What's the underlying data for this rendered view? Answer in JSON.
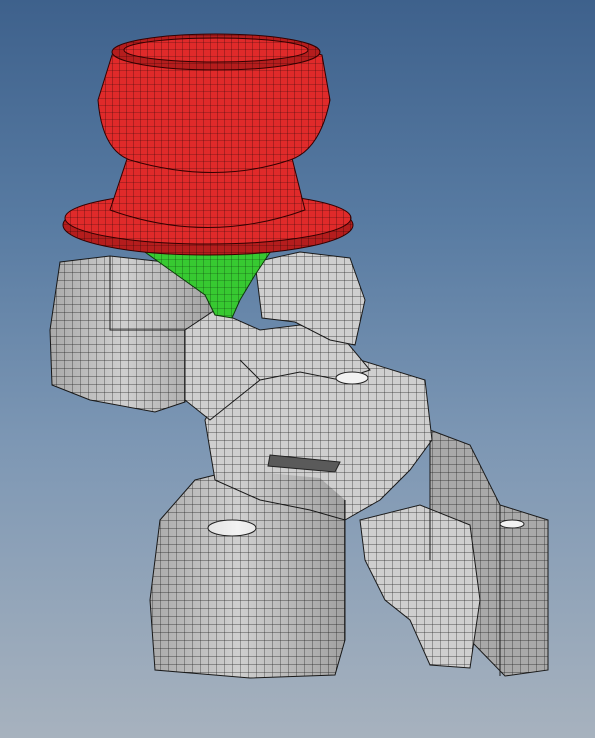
{
  "viewport": {
    "background_top": "#3e618c",
    "background_bottom": "#a7b2be"
  },
  "parts": [
    {
      "id": "bushing-cap",
      "kind": "mesh-part",
      "color": "#e02a2a"
    },
    {
      "id": "rubber-core",
      "kind": "mesh-part",
      "color": "#2fc42a"
    },
    {
      "id": "bracket",
      "kind": "mesh-part",
      "color": "#c9c9c9"
    }
  ],
  "mesh_style": {
    "edge_color": "#1a1a1a"
  }
}
